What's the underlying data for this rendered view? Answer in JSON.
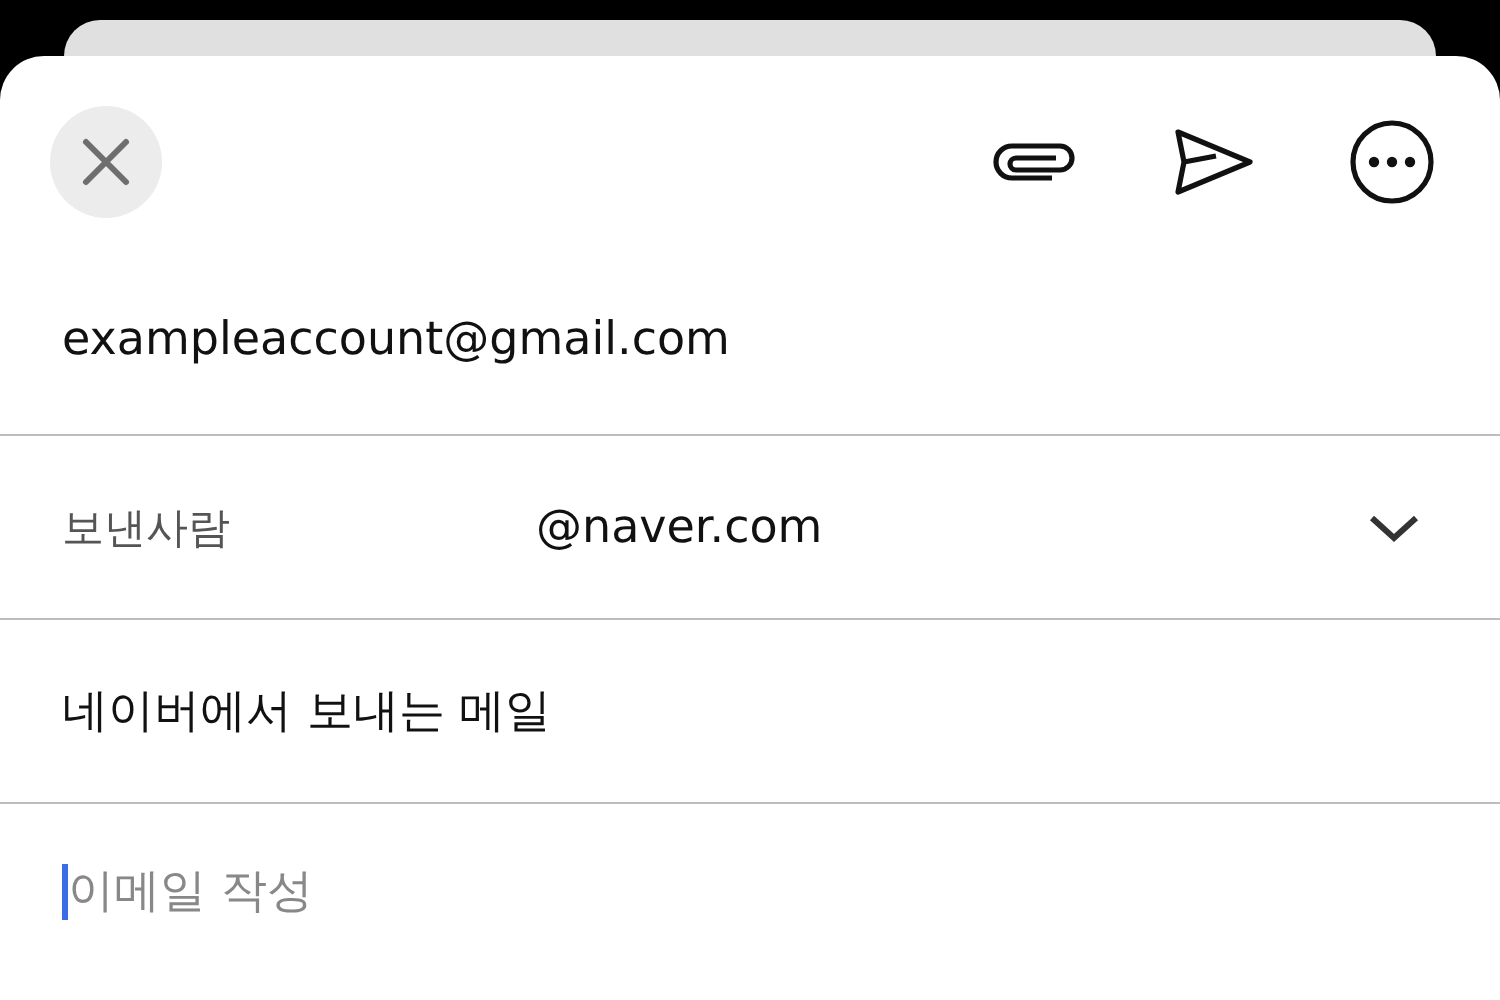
{
  "recipient": {
    "value": "exampleaccount@gmail.com"
  },
  "sender": {
    "label": "보낸사람",
    "value": "@naver.com"
  },
  "subject": {
    "value": "네이버에서 보내는 메일"
  },
  "body": {
    "placeholder": "이메일 작성"
  }
}
